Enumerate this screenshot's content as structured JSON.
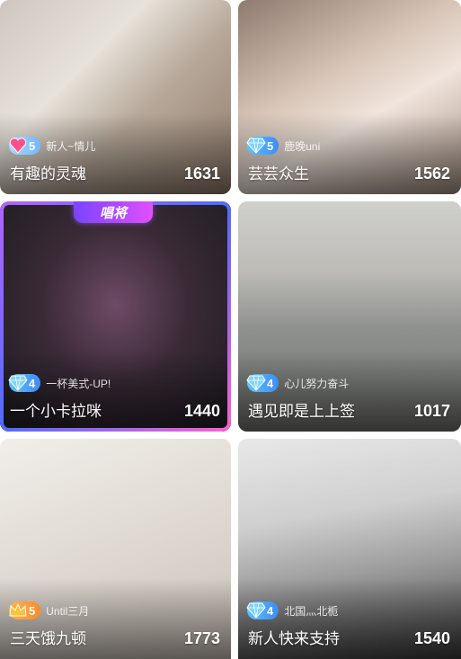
{
  "cards": [
    {
      "title": "有趣的灵魂",
      "count": "1631",
      "badge_level": "5",
      "badge_style": "pink",
      "author": "新人~情儿"
    },
    {
      "title": "芸芸众生",
      "count": "1562",
      "badge_level": "5",
      "badge_style": "blue",
      "author": "鹿晚uni"
    },
    {
      "title": "一个小卡拉咪",
      "count": "1440",
      "badge_level": "4",
      "badge_style": "blue",
      "author": "一杯美式-UP!",
      "tag": "唱将"
    },
    {
      "title": "遇见即是上上签",
      "count": "1017",
      "badge_level": "4",
      "badge_style": "blue",
      "author": "心儿努力奋斗"
    },
    {
      "title": "三天饿九顿",
      "count": "1773",
      "badge_level": "5",
      "badge_style": "gold",
      "author": "Until三月"
    },
    {
      "title": "新人快来支持",
      "count": "1540",
      "badge_level": "4",
      "badge_style": "blue",
      "author": "北国灬北栀"
    }
  ],
  "colors": {
    "accent_blue": "#3d8cf7",
    "frame_purple": "#b463ff",
    "gold": "#ff8a2b"
  }
}
